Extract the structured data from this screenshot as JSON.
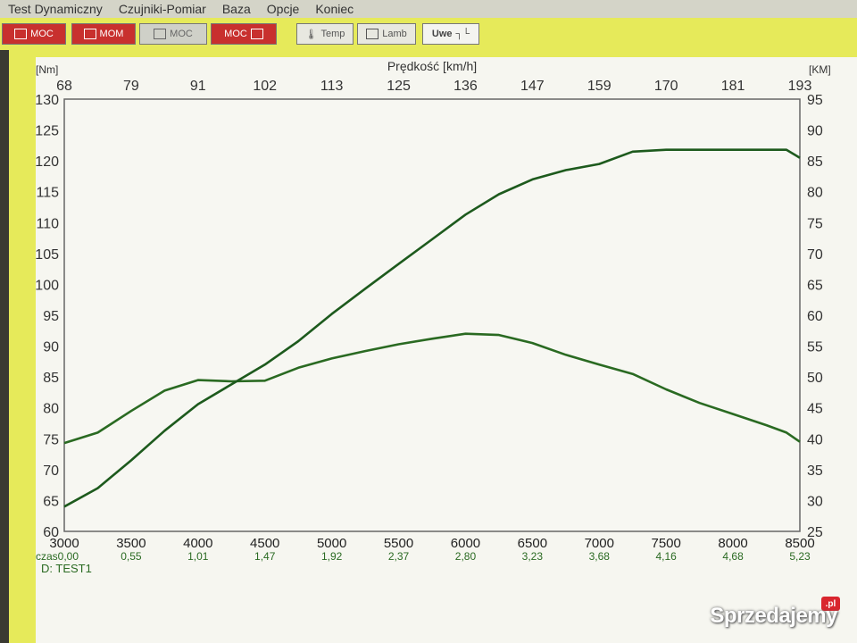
{
  "menu": [
    "Test Dynamiczny",
    "Czujniki-Pomiar",
    "Baza",
    "Opcje",
    "Koniec"
  ],
  "toolbar": {
    "buttons": [
      {
        "label": "MOC",
        "style": "red"
      },
      {
        "label": "MOM",
        "style": "red"
      },
      {
        "label": "MOC",
        "style": "grey"
      },
      {
        "label": "MOC",
        "style": "red"
      },
      {
        "label": "Temp",
        "style": "light"
      },
      {
        "label": "Lamb",
        "style": "light"
      },
      {
        "label": "Uwe",
        "style": "white"
      }
    ]
  },
  "watermark": {
    "text": "Sprzedajemy",
    "badge": ".pl"
  },
  "chart_data": {
    "type": "line",
    "left_unit": "[Nm]",
    "right_unit": "[KM]",
    "top_label": "Prędkość [km/h]",
    "x": [
      3000,
      3250,
      3500,
      3750,
      4000,
      4250,
      4500,
      4750,
      5000,
      5250,
      5500,
      5750,
      6000,
      6250,
      6500,
      6750,
      7000,
      7250,
      7500,
      7750,
      8000,
      8250,
      8400,
      8500
    ],
    "xlim": [
      3000,
      8500
    ],
    "x_ticks": [
      "3000",
      "3500",
      "4000",
      "4500",
      "5000",
      "5500",
      "6000",
      "6500",
      "7000",
      "7500",
      "8000",
      "8500"
    ],
    "time_ticks": [
      "0,55",
      "1,01",
      "1,47",
      "1,92",
      "2,37",
      "2,80",
      "3,23",
      "3,68",
      "4,16",
      "4,68",
      "5,23"
    ],
    "time_start_label": "czas0,00",
    "test_label": "D:  TEST1",
    "speed_ticks": [
      "68",
      "79",
      "91",
      "102",
      "113",
      "125",
      "136",
      "147",
      "159",
      "170",
      "181",
      "193"
    ],
    "ylim_left": [
      60,
      130
    ],
    "left_ticks": [
      "60",
      "65",
      "70",
      "75",
      "80",
      "85",
      "90",
      "95",
      "100",
      "105",
      "110",
      "115",
      "120",
      "125",
      "130"
    ],
    "ylim_right": [
      25,
      95
    ],
    "right_ticks": [
      "25",
      "30",
      "35",
      "40",
      "45",
      "50",
      "55",
      "60",
      "65",
      "70",
      "75",
      "80",
      "85",
      "90",
      "95"
    ],
    "grid": true,
    "series": [
      {
        "axis": "left",
        "color": "#2a6a22",
        "values": [
          74.3,
          76.0,
          79.5,
          82.8,
          84.5,
          84.3,
          84.4,
          86.5,
          88.0,
          89.2,
          90.3,
          91.2,
          92.0,
          91.8,
          90.5,
          88.6,
          87.0,
          85.5,
          83.0,
          80.8,
          79.0,
          77.2,
          76.0,
          74.5
        ]
      },
      {
        "axis": "right",
        "color": "#1d5a1d",
        "values": [
          29.0,
          32.0,
          36.5,
          41.3,
          45.6,
          48.8,
          52.0,
          55.8,
          60.2,
          64.3,
          68.3,
          72.3,
          76.3,
          79.6,
          82.0,
          83.5,
          84.5,
          86.5,
          86.8,
          86.8,
          86.8,
          86.8,
          86.8,
          85.5
        ]
      }
    ]
  }
}
